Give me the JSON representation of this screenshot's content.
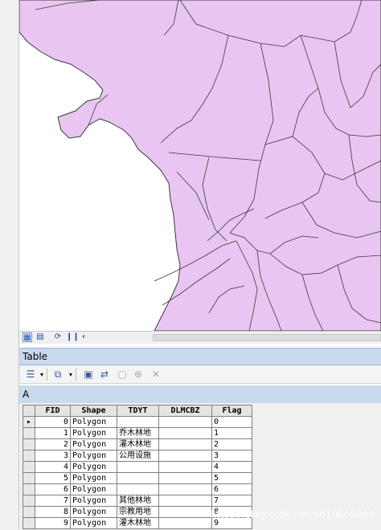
{
  "colors": {
    "polygon_fill": "#e9c6f1",
    "polygon_stroke": "#3a3a3a",
    "title_bar": "#c9d9ee"
  },
  "map": {
    "icons": [
      "data-view-icon",
      "layout-view-icon",
      "refresh-icon",
      "pause-icon",
      "scroll-left-icon"
    ]
  },
  "table_window": {
    "title": "Table",
    "layer_tab": "A",
    "toolbar_icons": [
      "table-options-icon",
      "related-tables-icon",
      "select-by-attributes-icon",
      "switch-selection-icon",
      "clear-selection-icon",
      "zoom-to-selected-icon",
      "delete-selected-icon"
    ]
  },
  "attribute_table": {
    "columns": [
      "FID",
      "Shape",
      "TDYT",
      "DLMCBZ",
      "Flag"
    ],
    "rows": [
      {
        "FID": "0",
        "Shape": "Polygon",
        "TDYT": "",
        "DLMCBZ": "",
        "Flag": "0"
      },
      {
        "FID": "1",
        "Shape": "Polygon",
        "TDYT": "乔木林地",
        "DLMCBZ": "",
        "Flag": "1"
      },
      {
        "FID": "2",
        "Shape": "Polygon",
        "TDYT": "灌木林地",
        "DLMCBZ": "",
        "Flag": "2"
      },
      {
        "FID": "3",
        "Shape": "Polygon",
        "TDYT": "公用设施",
        "DLMCBZ": "",
        "Flag": "3"
      },
      {
        "FID": "4",
        "Shape": "Polygon",
        "TDYT": "",
        "DLMCBZ": "",
        "Flag": "4"
      },
      {
        "FID": "5",
        "Shape": "Polygon",
        "TDYT": "",
        "DLMCBZ": "",
        "Flag": "5"
      },
      {
        "FID": "6",
        "Shape": "Polygon",
        "TDYT": "",
        "DLMCBZ": "",
        "Flag": "6"
      },
      {
        "FID": "7",
        "Shape": "Polygon",
        "TDYT": "其他林地",
        "DLMCBZ": "",
        "Flag": "7"
      },
      {
        "FID": "8",
        "Shape": "Polygon",
        "TDYT": "宗教用地",
        "DLMCBZ": "",
        "Flag": "8"
      },
      {
        "FID": "9",
        "Shape": "Polygon",
        "TDYT": "灌木林地",
        "DLMCBZ": "",
        "Flag": "9"
      }
    ],
    "current_row_marker": "▸"
  },
  "watermark": "https://blog.csdn.net/u010608964"
}
